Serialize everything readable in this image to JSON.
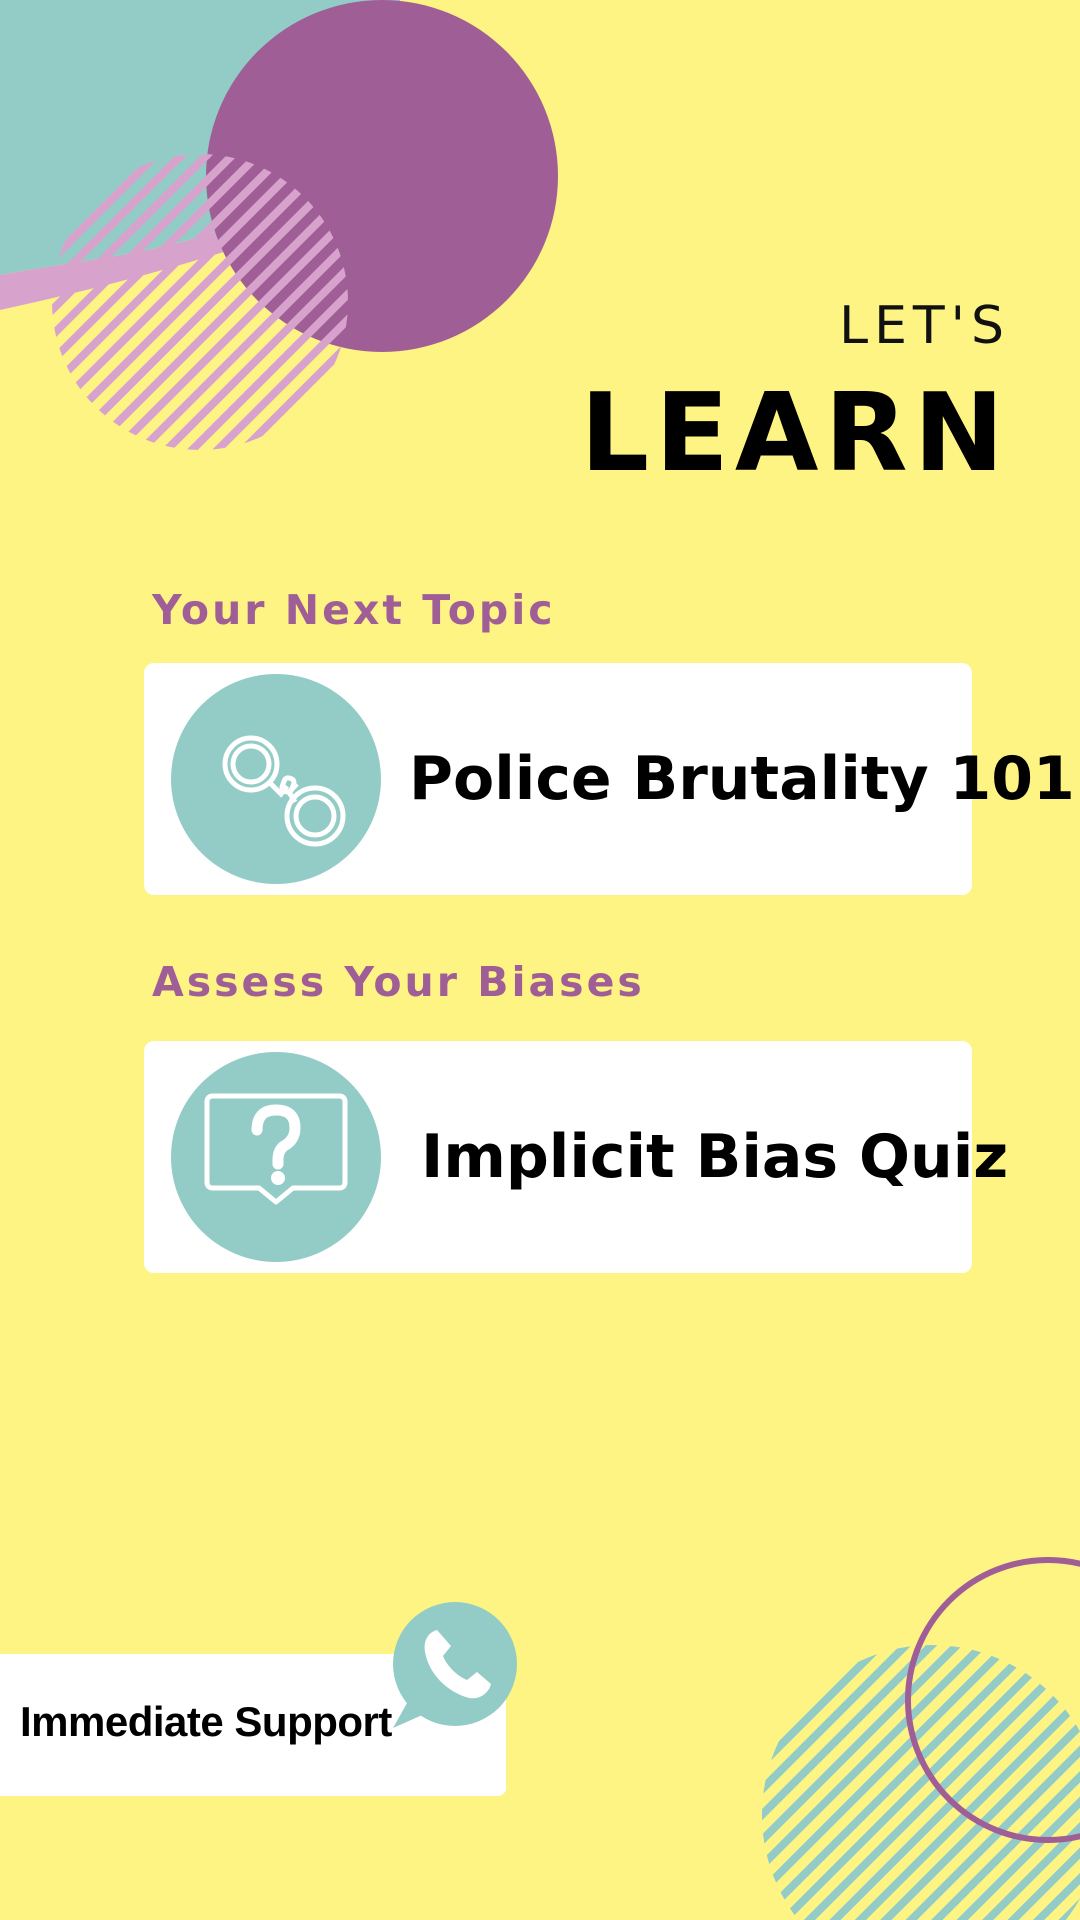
{
  "header": {
    "kicker": "LET'S",
    "title": "LEARN"
  },
  "sections": [
    {
      "label": "Your Next Topic",
      "card_title": "Police Brutality 101",
      "icon": "handcuffs-icon"
    },
    {
      "label": "Assess Your Biases",
      "card_title": "Implicit Bias Quiz",
      "icon": "question-bubble-icon"
    }
  ],
  "support": {
    "label": "Immediate Support",
    "icon": "phone-icon"
  },
  "colors": {
    "background": "#FEF483",
    "teal": "#93CCC6",
    "purple": "#A05E97",
    "card": "#FFFFFF",
    "text": "#000000"
  }
}
